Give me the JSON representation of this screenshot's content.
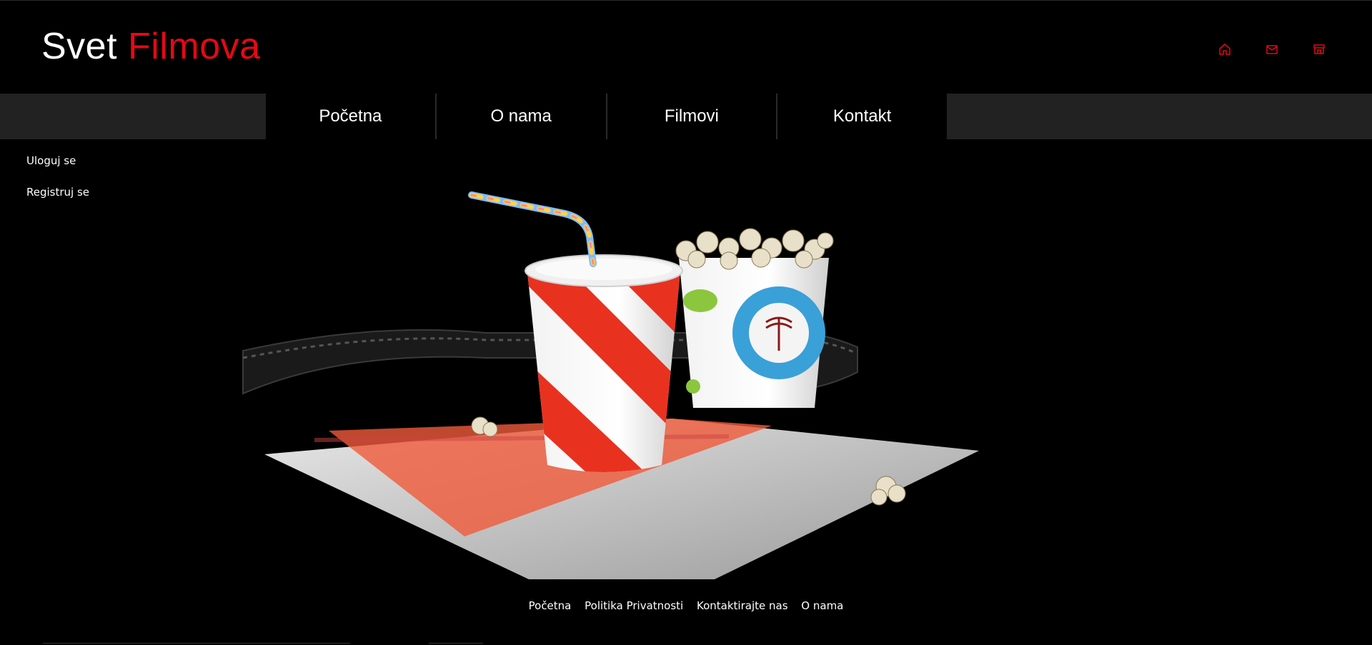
{
  "logo": {
    "part1": "Svet",
    "part2": "Filmova"
  },
  "header_icons": [
    "home-icon",
    "mail-icon",
    "store-icon"
  ],
  "accent_color": "#e50914",
  "nav": {
    "items": [
      "Početna",
      "O nama",
      "Filmovi",
      "Kontakt"
    ]
  },
  "sidebar": {
    "login": "Uloguj se",
    "register": "Registruj se"
  },
  "hero": {
    "image": "popcorn-soda-film-reel-illustration"
  },
  "footer": {
    "links": [
      "Početna",
      "Politika Privatnosti",
      "Kontaktirajte nas",
      "O nama"
    ]
  }
}
